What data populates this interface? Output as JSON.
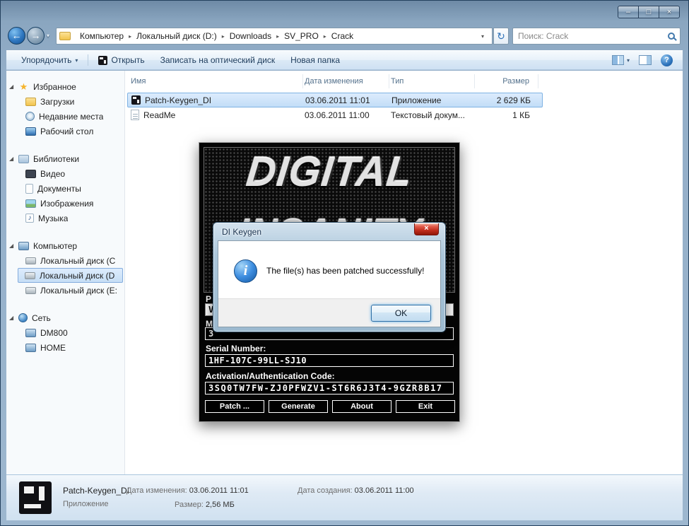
{
  "window": {
    "minimize_glyph": "–",
    "maximize_glyph": "□",
    "close_glyph": "×"
  },
  "icons": {
    "star": "★",
    "music": "♪"
  },
  "address_bar": {
    "back_glyph": "←",
    "forward_glyph": "→",
    "history_dropdown_glyph": "▾",
    "separator": "▸",
    "dropdown_glyph": "▾",
    "refresh_glyph": "↻",
    "search_text": "Поиск: Crack",
    "breadcrumb": [
      {
        "label": "Компьютер"
      },
      {
        "label": "Локальный диск (D:)"
      },
      {
        "label": "Downloads"
      },
      {
        "label": "SV_PRO"
      },
      {
        "label": "Crack"
      }
    ]
  },
  "toolbar": {
    "organize": "Упорядочить",
    "organize_arrow": "▾",
    "open": "Открыть",
    "burn": "Записать на оптический диск",
    "new_folder": "Новая папка",
    "views_arrow": "▾",
    "help_glyph": "?"
  },
  "sidebar": {
    "expander": "◢",
    "groups": [
      {
        "label": "Избранное",
        "items": [
          {
            "label": "Загрузки"
          },
          {
            "label": "Недавние места"
          },
          {
            "label": "Рабочий стол"
          }
        ]
      },
      {
        "label": "Библиотеки",
        "items": [
          {
            "label": "Видео"
          },
          {
            "label": "Документы"
          },
          {
            "label": "Изображения"
          },
          {
            "label": "Музыка"
          }
        ]
      },
      {
        "label": "Компьютер",
        "items": [
          {
            "label": "Локальный диск (C"
          },
          {
            "label": "Локальный диск (D"
          },
          {
            "label": "Локальный диск (E:"
          }
        ]
      },
      {
        "label": "Сеть",
        "items": [
          {
            "label": "DM800"
          },
          {
            "label": "HOME"
          }
        ]
      }
    ]
  },
  "file_list": {
    "columns": {
      "name": "Имя",
      "date": "Дата изменения",
      "type": "Тип",
      "size": "Размер"
    },
    "rows": [
      {
        "name": "Patch-Keygen_DI",
        "date": "03.06.2011 11:01",
        "type": "Приложение",
        "size": "2 629 КБ"
      },
      {
        "name": "ReadMe",
        "date": "03.06.2011 11:00",
        "type": "Текстовый докум...",
        "size": "1 КБ"
      }
    ]
  },
  "keygen": {
    "logo_line1": "DIGITAL",
    "logo_line2": "INSANITY",
    "partial_label_1": "P",
    "combo_value": "V",
    "partial_label_2": "M",
    "partial_field_value": "3",
    "serial_label": "Serial Number:",
    "serial_value": "1HF-107C-99LL-SJ10",
    "activation_label": "Activation/Authentication Code:",
    "activation_value": "3SQ0TW7FW-ZJ0PFWZV1-ST6R6J3T4-9GZR8B17",
    "buttons": {
      "patch": "Patch ...",
      "generate": "Generate",
      "about": "About",
      "exit": "Exit"
    }
  },
  "dialog": {
    "title": "DI Keygen",
    "close_glyph": "×",
    "info_glyph": "i",
    "message": "The file(s) has been patched successfully!",
    "ok": "OK"
  },
  "details": {
    "name": "Patch-Keygen_DI",
    "type": "Приложение",
    "modified_label": "Дата изменения:",
    "modified_value": "03.06.2011 11:01",
    "size_label": "Размер:",
    "size_value": "2,56 МБ",
    "created_label": "Дата создания:",
    "created_value": "03.06.2011 11:00"
  }
}
